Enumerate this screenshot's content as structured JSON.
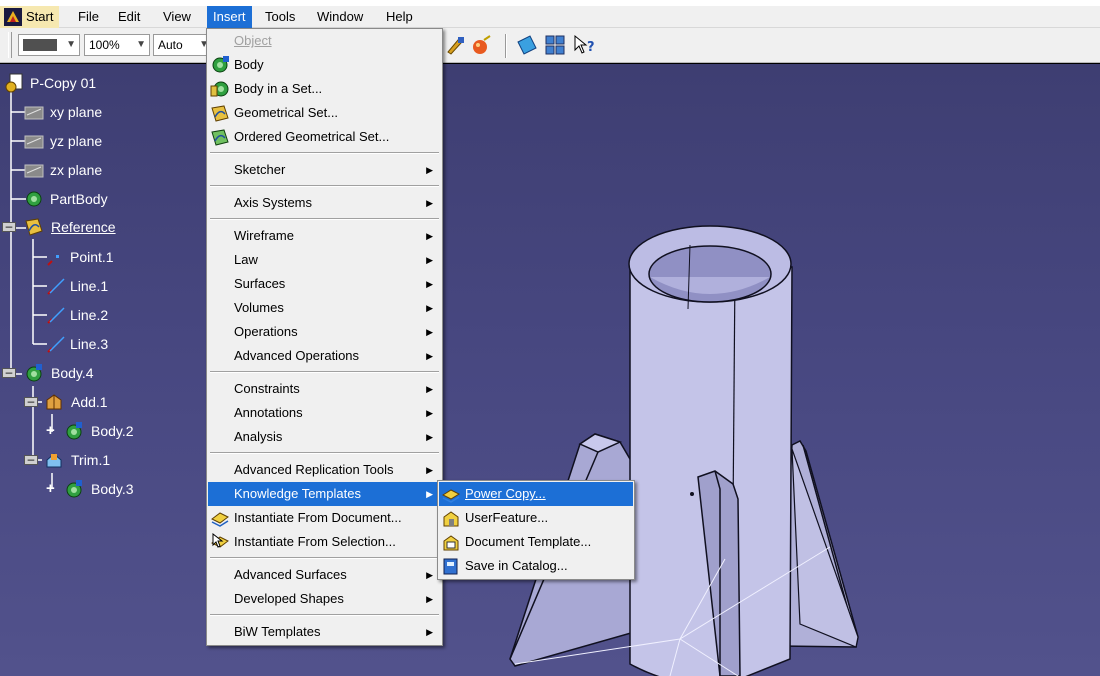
{
  "menubar": {
    "start": "Start",
    "file": "File",
    "edit": "Edit",
    "view": "View",
    "insert": "Insert",
    "tools": "Tools",
    "window": "Window",
    "help": "Help"
  },
  "toolbar": {
    "zoom": "100%",
    "mode": "Auto"
  },
  "tree": {
    "root": "P-Copy 01",
    "xy": "xy plane",
    "yz": "yz plane",
    "zx": "zx plane",
    "partbody": "PartBody",
    "reference": "Reference",
    "point1": "Point.1",
    "line1": "Line.1",
    "line2": "Line.2",
    "line3": "Line.3",
    "body4": "Body.4",
    "add1": "Add.1",
    "body2": "Body.2",
    "trim1": "Trim.1",
    "body3": "Body.3"
  },
  "insert_menu": {
    "object": "Object",
    "body": "Body",
    "body_in_set": "Body in a Set...",
    "geo_set": "Geometrical Set...",
    "ordered_geo_set": "Ordered Geometrical Set...",
    "sketcher": "Sketcher",
    "axis_systems": "Axis Systems",
    "wireframe": "Wireframe",
    "law": "Law",
    "surfaces": "Surfaces",
    "volumes": "Volumes",
    "operations": "Operations",
    "advanced_operations": "Advanced Operations",
    "constraints": "Constraints",
    "annotations": "Annotations",
    "analysis": "Analysis",
    "adv_replication": "Advanced Replication Tools",
    "knowledge_templates": "Knowledge Templates",
    "instantiate_doc": "Instantiate From Document...",
    "instantiate_sel": "Instantiate From Selection...",
    "advanced_surfaces": "Advanced Surfaces",
    "developed_shapes": "Developed Shapes",
    "biw_templates": "BiW Templates"
  },
  "knowledge_menu": {
    "power_copy": "Power Copy...",
    "user_feature": "UserFeature...",
    "document_template": "Document Template...",
    "save_in_catalog": "Save in Catalog..."
  }
}
